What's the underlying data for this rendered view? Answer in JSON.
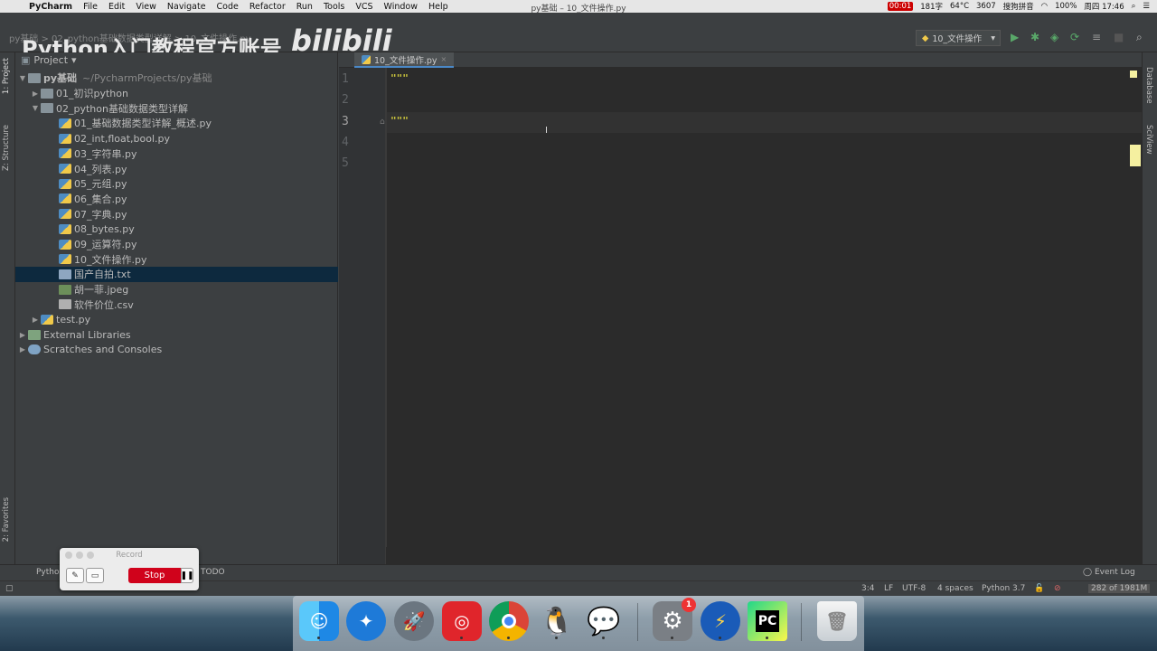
{
  "menubar": {
    "app": "PyCharm",
    "menus": [
      "File",
      "Edit",
      "View",
      "Navigate",
      "Code",
      "Refactor",
      "Run",
      "Tools",
      "VCS",
      "Window",
      "Help"
    ],
    "window_title": "py基础 – 10_文件操作.py",
    "record_time": "00:01",
    "word_count": "181字",
    "temp": "64°C",
    "fan": "3607",
    "ime": "搜狗拼音",
    "battery": "100%",
    "clock": "周四 17:46"
  },
  "toolbar": {
    "breadcrumbs": "py基础 > 02_python基础数据类型详解 > 10_文件操作.py",
    "watermark": "Python入门教程官方账号",
    "bili": "bilibili",
    "run_config": "10_文件操作"
  },
  "left_strip": {
    "project_tab": "1: Project",
    "structure_tab": "Z: Structure",
    "favorites_tab": "2: Favorites"
  },
  "project": {
    "header": "Project",
    "root": "py基础",
    "root_path": "~/PycharmProjects/py基础",
    "items": [
      {
        "label": "01_初识python"
      },
      {
        "label": "02_python基础数据类型详解"
      },
      {
        "label": "01_基础数据类型详解_概述.py"
      },
      {
        "label": "02_int,float,bool.py"
      },
      {
        "label": "03_字符串.py"
      },
      {
        "label": "04_列表.py"
      },
      {
        "label": "05_元组.py"
      },
      {
        "label": "06_集合.py"
      },
      {
        "label": "07_字典.py"
      },
      {
        "label": "08_bytes.py"
      },
      {
        "label": "09_运算符.py"
      },
      {
        "label": "10_文件操作.py"
      },
      {
        "label": "国产自拍.txt"
      },
      {
        "label": "胡一菲.jpeg"
      },
      {
        "label": "软件价位.csv"
      },
      {
        "label": "test.py"
      },
      {
        "label": "External Libraries"
      },
      {
        "label": "Scratches and Consoles"
      }
    ]
  },
  "editor": {
    "tab": "10_文件操作.py",
    "line_numbers": [
      "1",
      "2",
      "3",
      "4",
      "5"
    ],
    "lines": [
      "\"\"\"",
      "",
      "\"\"\"",
      "",
      ""
    ]
  },
  "right_strip": {
    "database": "Database",
    "sciview": "SciView"
  },
  "bottom_tools": {
    "python_console": "Python",
    "todo": "TODO",
    "event_log": "Event Log"
  },
  "status": {
    "position": "3:4",
    "line_sep": "LF",
    "encoding": "UTF-8",
    "indent": "4 spaces",
    "interpreter": "Python 3.7",
    "memory": "282 of 1981M"
  },
  "recorder": {
    "title": "Record",
    "stop": "Stop"
  },
  "dock": {
    "settings_badge": "1"
  }
}
